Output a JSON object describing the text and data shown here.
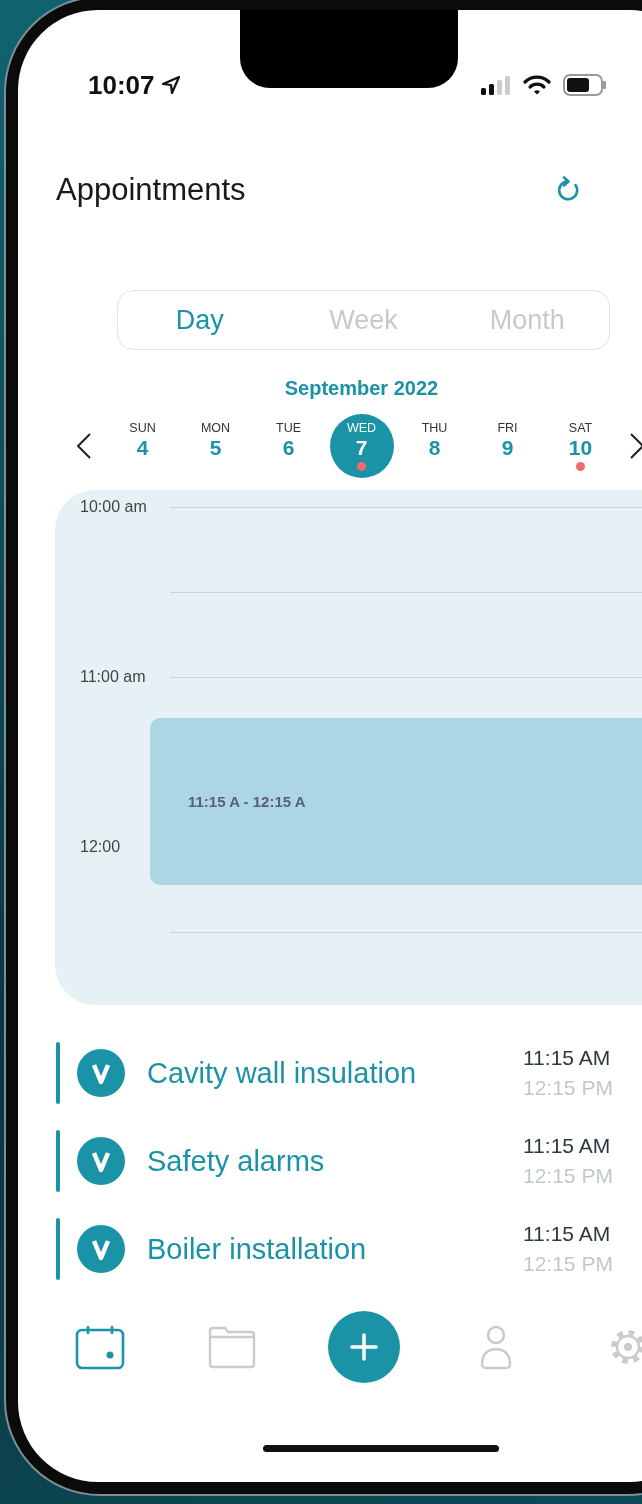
{
  "status_bar": {
    "time": "10:07"
  },
  "header": {
    "title": "Appointments"
  },
  "view_tabs": [
    {
      "label": "Day",
      "selected": true
    },
    {
      "label": "Week",
      "selected": false
    },
    {
      "label": "Month",
      "selected": false
    }
  ],
  "calendar": {
    "month": "September 2022",
    "days": [
      {
        "weekday": "SUN",
        "date": "4",
        "selected": false,
        "has_event": false
      },
      {
        "weekday": "MON",
        "date": "5",
        "selected": false,
        "has_event": false
      },
      {
        "weekday": "TUE",
        "date": "6",
        "selected": false,
        "has_event": false
      },
      {
        "weekday": "WED",
        "date": "7",
        "selected": true,
        "has_event": true
      },
      {
        "weekday": "THU",
        "date": "8",
        "selected": false,
        "has_event": false
      },
      {
        "weekday": "FRI",
        "date": "9",
        "selected": false,
        "has_event": false
      },
      {
        "weekday": "SAT",
        "date": "10",
        "selected": false,
        "has_event": true
      }
    ]
  },
  "timeline": {
    "hour_labels": [
      "10:00 am",
      "11:00 am",
      "12:00"
    ],
    "event": {
      "time_range": "11:15 A - 12:15 A"
    }
  },
  "appointments": [
    {
      "title": "Cavity wall insulation",
      "start": "11:15 AM",
      "end": "12:15 PM"
    },
    {
      "title": "Safety alarms",
      "start": "11:15 AM",
      "end": "12:15 PM"
    },
    {
      "title": "Boiler installation",
      "start": "11:15 AM",
      "end": "12:15 PM"
    }
  ],
  "tab_bar": [
    {
      "kind": "calendar",
      "selected": true
    },
    {
      "kind": "folder",
      "selected": false
    },
    {
      "kind": "add"
    },
    {
      "kind": "person",
      "selected": false
    },
    {
      "kind": "settings",
      "selected": false
    }
  ]
}
